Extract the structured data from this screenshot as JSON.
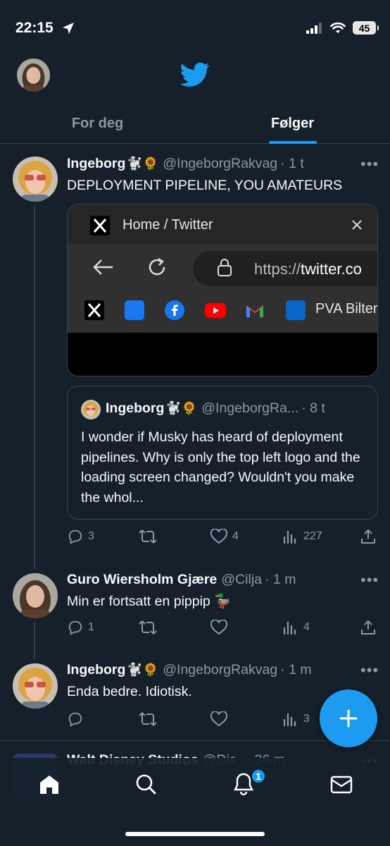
{
  "status": {
    "time": "22:15",
    "battery": "45"
  },
  "tabs": [
    {
      "label": "For deg",
      "active": false
    },
    {
      "label": "Følger",
      "active": true
    }
  ],
  "tweets": [
    {
      "name": "Ingeborg",
      "emojis": "🐩🌻",
      "handle": "@IngeborgRakvag",
      "time": "· 1 t",
      "text": "DEPLOYMENT PIPELINE, YOU AMATEURS",
      "media": {
        "tab_title": "Home / Twitter",
        "url_prefix": "https://",
        "url_host": "twitter.co",
        "bookmark_label": "PVA Bilter"
      },
      "quote": {
        "name": "Ingeborg",
        "emojis": "🐩🌻",
        "handle": "@IngeborgRa...",
        "time": "· 8 t",
        "text": "I wonder if Musky has heard of deployment pipelines. Why is only the top left logo and the loading screen changed? Wouldn't you make the whol..."
      },
      "stats": {
        "replies": "3",
        "retweets": "",
        "likes": "4",
        "views": "227"
      }
    },
    {
      "name": "Guro Wiersholm Gjære",
      "emojis": "",
      "handle": "@Cilja",
      "time": "· 1 m",
      "text": "Min er fortsatt en pippip 🦆",
      "stats": {
        "replies": "1",
        "retweets": "",
        "likes": "",
        "views": "4"
      }
    },
    {
      "name": "Ingeborg",
      "emojis": "🐩🌻",
      "handle": "@IngeborgRakvag",
      "time": "· 1 m",
      "text": "Enda bedre. Idiotisk.",
      "stats": {
        "replies": "",
        "retweets": "",
        "likes": "",
        "views": "3"
      }
    }
  ],
  "peek": {
    "name": "Walt Disney Studios",
    "handle": "@Dis",
    "time": "· 36 m"
  },
  "nav": {
    "notifications_badge": "1"
  },
  "colors": {
    "background": "#15202b",
    "accent": "#1d9bf0",
    "muted": "#8b98a5",
    "divider": "#38444d"
  },
  "icons": [
    "navigation-arrow-icon",
    "signal-icon",
    "wifi-icon",
    "battery-icon",
    "twitter-bird-icon",
    "reply-icon",
    "retweet-icon",
    "like-icon",
    "views-icon",
    "share-icon",
    "more-icon",
    "compose-icon",
    "home-icon",
    "search-icon",
    "notifications-icon",
    "messages-icon"
  ]
}
